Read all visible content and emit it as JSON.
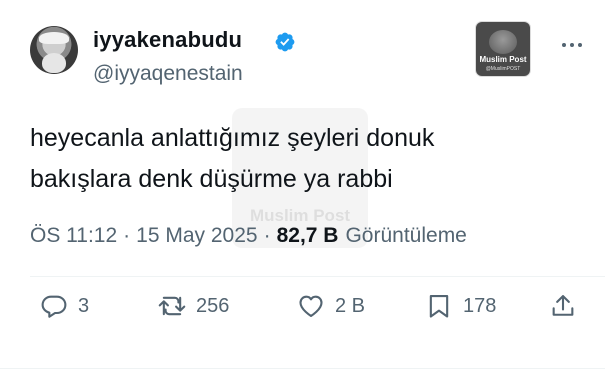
{
  "author": {
    "display_name": "iyyakenabudu",
    "handle": "@iyyaqenestain",
    "verified": true,
    "accent_color": "#1d9bf0"
  },
  "logo": {
    "name": "Muslim Post",
    "sub": "@MuslimPOST"
  },
  "watermark": {
    "text": "Muslim Post"
  },
  "tweet": {
    "lines": [
      "heyecanla anlattığımız şeyleri donuk",
      "bakışlara denk düşürme ya rabbi"
    ]
  },
  "meta": {
    "time": "ÖS 11:12",
    "date": "15 May 2025",
    "views_count": "82,7 B",
    "views_label": "Görüntüleme"
  },
  "actions": {
    "replies": "3",
    "retweets": "256",
    "likes": "2 B",
    "bookmarks": "178"
  },
  "icons": {
    "reply": "reply-icon",
    "retweet": "retweet-icon",
    "like": "heart-icon",
    "bookmark": "bookmark-icon",
    "share": "share-icon",
    "more": "more-icon",
    "verified": "verified-badge-icon"
  }
}
